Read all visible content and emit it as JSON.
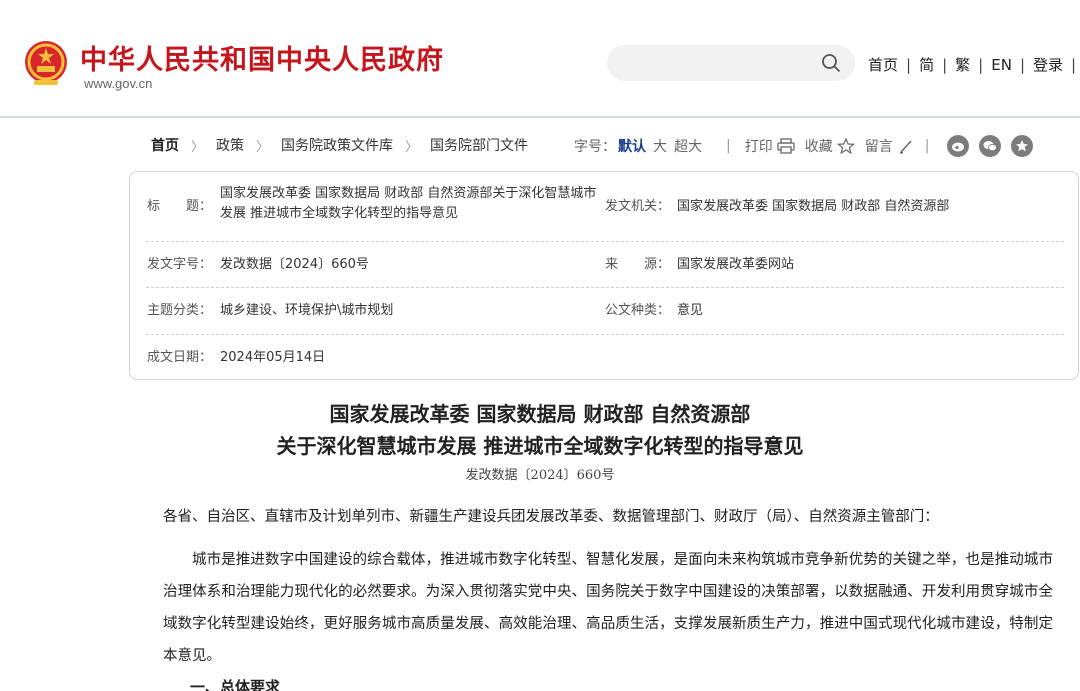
{
  "header": {
    "site_title": "中华人民共和国中央人民政府",
    "site_url": "www.gov.cn",
    "search_placeholder": "",
    "nav": [
      "首页",
      "简",
      "繁",
      "EN",
      "登录"
    ]
  },
  "breadcrumb": [
    "首页",
    "政策",
    "国务院政策文件库",
    "国务院部门文件"
  ],
  "tools": {
    "font_label": "字号：",
    "font_default": "默认",
    "font_large": "大",
    "font_xlarge": "超大",
    "divider": "|",
    "print": "打印",
    "favorite": "收藏",
    "comment": "留言"
  },
  "info": {
    "title_label": "标　　题：",
    "title_value": "国家发展改革委 国家数据局 财政部 自然资源部关于深化智慧城市发展 推进城市全域数字化转型的指导意见",
    "issuer_label": "发文机关：",
    "issuer_value": "国家发展改革委 国家数据局 财政部 自然资源部",
    "docno_label": "发文字号：",
    "docno_value": "发改数据〔2024〕660号",
    "source_label": "来　　源：",
    "source_value": "国家发展改革委网站",
    "topic_label": "主题分类：",
    "topic_value": "城乡建设、环境保护\\城市规划",
    "type_label": "公文种类：",
    "type_value": "意见",
    "date_label": "成文日期：",
    "date_value": "2024年05月14日"
  },
  "article": {
    "title_line1": "国家发展改革委 国家数据局 财政部 自然资源部",
    "title_line2": "关于深化智慧城市发展 推进城市全域数字化转型的指导意见",
    "doc_number": "发改数据〔2024〕660号",
    "salutation": "各省、自治区、直辖市及计划单列市、新疆生产建设兵团发展改革委、数据管理部门、财政厅（局）、自然资源主管部门：",
    "para1": "城市是推进数字中国建设的综合载体，推进城市数字化转型、智慧化发展，是面向未来构筑城市竞争新优势的关键之举，也是推动城市治理体系和治理能力现代化的必然要求。为深入贯彻落实党中央、国务院关于数字中国建设的决策部署，以数据融通、开发利用贯穿城市全域数字化转型建设始终，更好服务城市高质量发展、高效能治理、高品质生活，支撑发展新质生产力，推进中国式现代化城市建设，特制定本意见。",
    "section1": "一、总体要求"
  },
  "colors": {
    "brand_red": "#c4161c",
    "link_blue": "#1a3d8f"
  }
}
